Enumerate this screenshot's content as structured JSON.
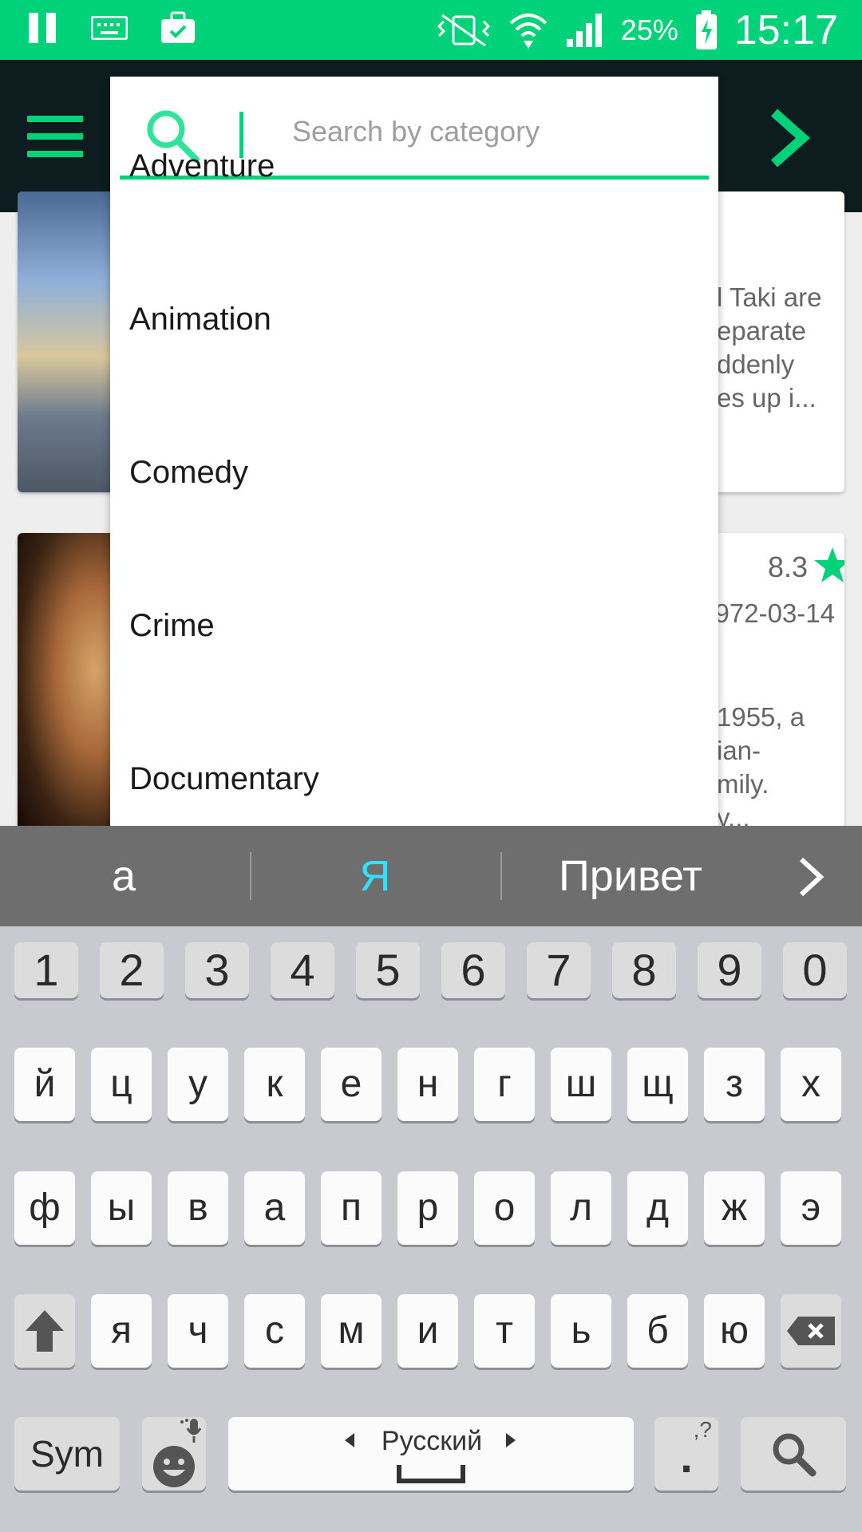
{
  "status_bar": {
    "battery_pct": "25%",
    "time": "15:17",
    "icons": [
      "pause-icon",
      "keyboard-icon",
      "briefcase-check-icon",
      "vibrate-mute-icon",
      "wifi-icon",
      "signal-icon",
      "battery-charging-icon"
    ]
  },
  "app_bar": {
    "menu_icon": "menu-icon",
    "next_icon": "chevron-right-icon"
  },
  "search": {
    "placeholder": "Search by category",
    "value": ""
  },
  "categories": [
    "Adventure",
    "Animation",
    "Comedy",
    "Crime",
    "Documentary"
  ],
  "movies": [
    {
      "overview_lines": [
        "l Taki are",
        "eparate",
        "ddenly",
        "es up i..."
      ]
    },
    {
      "rating": "8.3",
      "date": "972-03-14",
      "overview_lines": [
        "1955, a",
        "ian-",
        "mily.",
        "y..."
      ]
    }
  ],
  "keyboard": {
    "suggestions": [
      "а",
      "Я",
      "Привет"
    ],
    "numbers": [
      "1",
      "2",
      "3",
      "4",
      "5",
      "6",
      "7",
      "8",
      "9",
      "0"
    ],
    "row1": [
      "й",
      "ц",
      "у",
      "к",
      "е",
      "н",
      "г",
      "ш",
      "щ",
      "з",
      "х"
    ],
    "row2": [
      "ф",
      "ы",
      "в",
      "а",
      "п",
      "р",
      "о",
      "л",
      "д",
      "ж",
      "э"
    ],
    "row3": [
      "я",
      "ч",
      "с",
      "м",
      "и",
      "т",
      "ь",
      "б",
      "ю"
    ],
    "sym_label": "Sym",
    "space_label": "Русский",
    "period_label": ".",
    "period_hint": ",?"
  },
  "colors": {
    "accent": "#00d27a",
    "app_bar": "#0d1c1f",
    "suggestion_highlight": "#33e0ff"
  }
}
